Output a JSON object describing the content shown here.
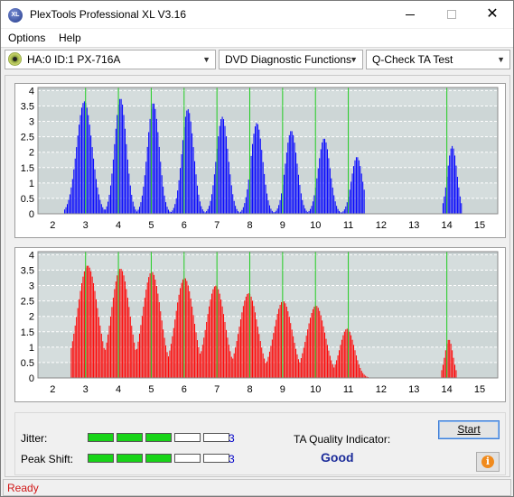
{
  "window": {
    "title": "PlexTools Professional XL V3.16",
    "app_icon_text": "XL"
  },
  "menu": {
    "options": "Options",
    "help": "Help"
  },
  "toolbar": {
    "drive": "HA:0 ID:1  PX-716A",
    "function": "DVD Diagnostic Functions",
    "test": "Q-Check TA Test"
  },
  "chart_data": [
    {
      "type": "bar",
      "color": "#0000ff",
      "x_ticks": [
        2,
        3,
        4,
        5,
        6,
        7,
        8,
        9,
        10,
        11,
        12,
        13,
        14,
        15
      ],
      "y_ticks": [
        "0",
        "0.5",
        "1",
        "1.5",
        "2",
        "2.5",
        "3",
        "3.5",
        "4"
      ],
      "xlim": [
        1.55,
        15.55
      ],
      "ylim": [
        0,
        4.1
      ],
      "grid": true,
      "peaks": [
        {
          "x": 2.95,
          "height": 3.65,
          "width": 0.42
        },
        {
          "x": 4.05,
          "height": 3.75,
          "width": 0.32
        },
        {
          "x": 5.05,
          "height": 3.6,
          "width": 0.32
        },
        {
          "x": 6.1,
          "height": 3.4,
          "width": 0.32
        },
        {
          "x": 7.15,
          "height": 3.15,
          "width": 0.32
        },
        {
          "x": 8.2,
          "height": 2.95,
          "width": 0.32
        },
        {
          "x": 9.25,
          "height": 2.7,
          "width": 0.32
        },
        {
          "x": 10.25,
          "height": 2.45,
          "width": 0.32
        },
        {
          "x": 11.25,
          "height": 1.85,
          "width": 0.3
        },
        {
          "x": 14.15,
          "height": 2.2,
          "width": 0.26
        }
      ],
      "range": [
        [
          2.35,
          11.5
        ],
        [
          13.85,
          14.45
        ]
      ],
      "green_lines": [
        3,
        4,
        5,
        6,
        7,
        8,
        9,
        10,
        11,
        14
      ]
    },
    {
      "type": "bar",
      "color": "#ff0000",
      "x_ticks": [
        2,
        3,
        4,
        5,
        6,
        7,
        8,
        9,
        10,
        11,
        12,
        13,
        14,
        15
      ],
      "y_ticks": [
        "0",
        "0.5",
        "1",
        "1.5",
        "2",
        "2.5",
        "3",
        "3.5",
        "4"
      ],
      "xlim": [
        1.55,
        15.55
      ],
      "ylim": [
        0,
        4.1
      ],
      "grid": true,
      "peaks": [
        {
          "x": 3.05,
          "height": 3.65,
          "width": 0.55
        },
        {
          "x": 4.05,
          "height": 3.55,
          "width": 0.5
        },
        {
          "x": 5.0,
          "height": 3.45,
          "width": 0.5
        },
        {
          "x": 6.0,
          "height": 3.25,
          "width": 0.5
        },
        {
          "x": 6.95,
          "height": 3.0,
          "width": 0.5
        },
        {
          "x": 7.95,
          "height": 2.75,
          "width": 0.5
        },
        {
          "x": 9.0,
          "height": 2.5,
          "width": 0.5
        },
        {
          "x": 10.0,
          "height": 2.35,
          "width": 0.5
        },
        {
          "x": 10.95,
          "height": 1.6,
          "width": 0.4
        },
        {
          "x": 14.05,
          "height": 1.25,
          "width": 0.22
        }
      ],
      "range": [
        [
          2.55,
          11.6
        ],
        [
          13.8,
          14.3
        ]
      ],
      "green_lines": [
        3,
        4,
        5,
        6,
        7,
        8,
        9,
        10,
        11,
        14
      ]
    }
  ],
  "results": {
    "jitter_label": "Jitter:",
    "jitter_value": "3",
    "jitter_level": 3,
    "peak_shift_label": "Peak Shift:",
    "peak_shift_value": "3",
    "peak_shift_level": 3,
    "segments": 5,
    "ta_label": "TA Quality Indicator:",
    "ta_value": "Good",
    "start_button": "Start"
  },
  "status": {
    "text": "Ready"
  }
}
